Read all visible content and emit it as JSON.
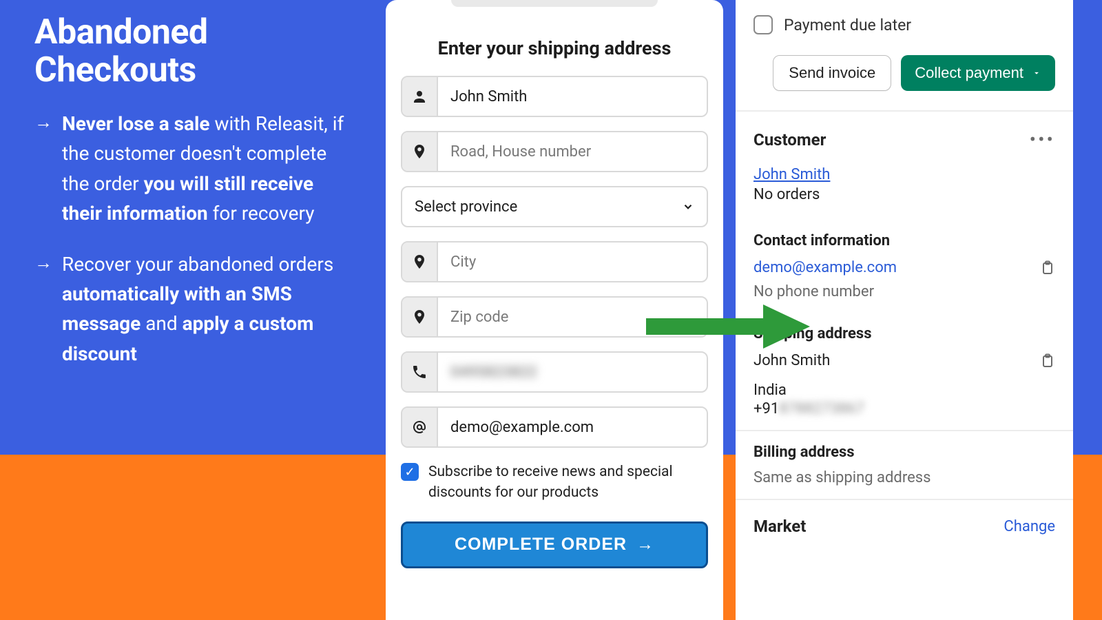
{
  "marketing": {
    "title_line1": "Abandoned",
    "title_line2": "Checkouts",
    "bullet1_bold_a": "Never lose a sale",
    "bullet1_mid": " with Releasit, if the customer doesn't complete the order ",
    "bullet1_bold_b": "you will still receive their information",
    "bullet1_end": " for recovery",
    "bullet2_start": "Recover your abandoned orders ",
    "bullet2_bold_a": "automatically with an SMS message",
    "bullet2_mid": " and ",
    "bullet2_bold_b": "apply a custom discount"
  },
  "form": {
    "title": "Enter your shipping address",
    "name_value": "John Smith",
    "address_placeholder": "Road, House number",
    "province_placeholder": "Select province",
    "city_placeholder": "City",
    "zip_placeholder": "Zip code",
    "phone_blurred": "0495823822",
    "email_value": "demo@example.com",
    "subscribe_label": "Subscribe to receive news and special discounts for our products",
    "complete_btn": "COMPLETE ORDER"
  },
  "admin": {
    "due_later_label": "Payment due later",
    "send_invoice_btn": "Send invoice",
    "collect_payment_btn": "Collect payment",
    "customer_heading": "Customer",
    "customer_name": "John Smith",
    "customer_orders": "No orders",
    "contact_heading": "Contact information",
    "contact_email": "demo@example.com",
    "contact_phone_placeholder": "No phone number",
    "shipping_heading": "Shipping address",
    "shipping_name": "John Smith",
    "shipping_country": "India",
    "shipping_phone_prefix": "+91",
    "shipping_phone_rest": "8788273867",
    "billing_heading": "Billing address",
    "billing_text": "Same as shipping address",
    "market_heading": "Market",
    "change_link": "Change"
  }
}
